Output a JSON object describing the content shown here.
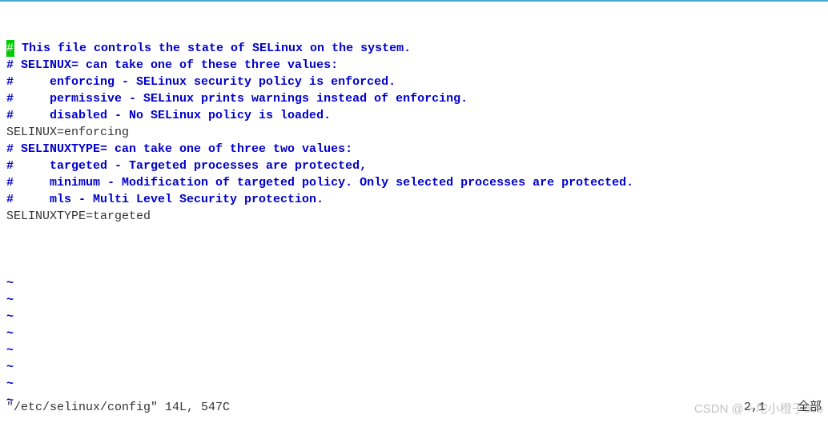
{
  "editor": {
    "lines": [
      {
        "type": "comment",
        "text": "# This file controls the state of SELinux on the system.",
        "cursor_first_char": true
      },
      {
        "type": "comment",
        "text": "# SELINUX= can take one of these three values:"
      },
      {
        "type": "comment",
        "text": "#     enforcing - SELinux security policy is enforced."
      },
      {
        "type": "comment",
        "text": "#     permissive - SELinux prints warnings instead of enforcing."
      },
      {
        "type": "comment",
        "text": "#     disabled - No SELinux policy is loaded."
      },
      {
        "type": "code",
        "text": "SELINUX=enforcing"
      },
      {
        "type": "comment",
        "text": "# SELINUXTYPE= can take one of three two values:"
      },
      {
        "type": "comment",
        "text": "#     targeted - Targeted processes are protected,"
      },
      {
        "type": "comment",
        "text": "#     minimum - Modification of targeted policy. Only selected processes are protected."
      },
      {
        "type": "comment",
        "text": "#     mls - Multi Level Security protection."
      },
      {
        "type": "code",
        "text": "SELINUXTYPE=targeted"
      },
      {
        "type": "blank",
        "text": ""
      }
    ],
    "tilde_count": 8,
    "tilde_char": "~"
  },
  "status": {
    "filename": "\"/etc/selinux/config\" 14L, 547C",
    "position": "2,1",
    "scroll": "全部"
  },
  "watermark": "CSDN @一坨小橙子ovo"
}
